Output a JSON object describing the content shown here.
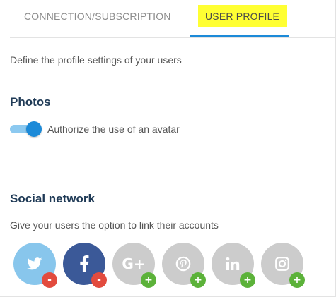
{
  "tabs": {
    "connection_label": "CONNECTION/SUBSCRIPTION",
    "profile_label": "USER PROFILE",
    "active": "USER PROFILE"
  },
  "intro": {
    "description": "Define the profile settings of your users"
  },
  "photos": {
    "heading": "Photos",
    "avatar_toggle": {
      "label": "Authorize the use of an avatar",
      "enabled": true
    }
  },
  "social": {
    "heading": "Social network",
    "description": "Give your users the option to link their accounts",
    "networks": [
      {
        "name": "twitter",
        "icon": "twitter-icon",
        "linked": true,
        "action": "-",
        "color": "#88c6ec",
        "action_color": "#e24b3e"
      },
      {
        "name": "facebook",
        "icon": "facebook-icon",
        "linked": true,
        "action": "-",
        "color": "#3b5998",
        "action_color": "#e24b3e"
      },
      {
        "name": "google-plus",
        "icon": "google-plus-icon",
        "linked": false,
        "action": "+",
        "color": "#cccccc",
        "action_color": "#5cb23a"
      },
      {
        "name": "pinterest",
        "icon": "pinterest-icon",
        "linked": false,
        "action": "+",
        "color": "#cccccc",
        "action_color": "#5cb23a"
      },
      {
        "name": "linkedin",
        "icon": "linkedin-icon",
        "linked": false,
        "action": "+",
        "color": "#cccccc",
        "action_color": "#5cb23a"
      },
      {
        "name": "instagram",
        "icon": "instagram-icon",
        "linked": false,
        "action": "+",
        "color": "#cccccc",
        "action_color": "#5cb23a"
      }
    ]
  },
  "colors": {
    "accent": "#1c8ad8",
    "heading": "#1f3a56",
    "highlight": "#ffff33"
  }
}
